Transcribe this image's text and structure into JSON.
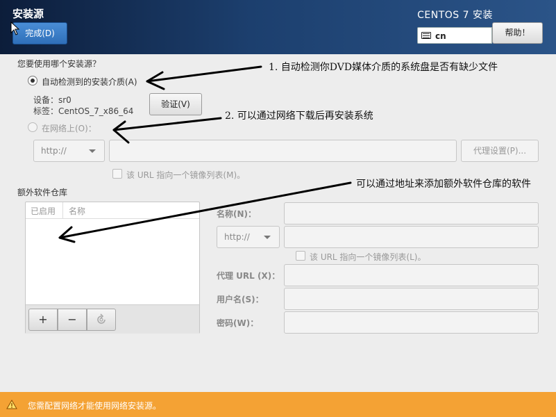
{
  "header": {
    "title": "安装源",
    "done_label": "完成(D)",
    "product": "CENTOS 7 安装",
    "keyboard_layout": "cn",
    "help_label": "帮助！"
  },
  "source": {
    "question": "您要使用哪个安装源？",
    "auto_label": "自动检测到的安装介质(A)",
    "auto_selected": true,
    "device_line": "设备：sr0",
    "label_line": "标签：CentOS_7_x86_64",
    "verify_label": "验证(V)",
    "network_label": "在网络上(O)：",
    "protocol_value": "http://",
    "url_value": "",
    "proxy_button": "代理设置(P)...",
    "mirror_checkbox_label": "该 URL 指向一个镜像列表(M)。"
  },
  "extra_repos": {
    "title": "额外软件仓库",
    "columns": [
      "已启用",
      "名称"
    ],
    "rows": [],
    "add_label": "+",
    "remove_label": "−",
    "refresh_label": "↻"
  },
  "repo_form": {
    "name_label": "名称(N)：",
    "protocol_value": "http://",
    "mirror_checkbox_label": "该 URL 指向一个镜像列表(L)。",
    "proxy_url_label": "代理 URL (X)：",
    "username_label": "用户名(S)：",
    "password_label": "密码(W)："
  },
  "warning": {
    "text": "您需配置网络才能使用网络安装源。",
    "color": "#f4a234"
  },
  "annotations": {
    "note1": "1. 自动检测你DVD媒体介质的系统盘是否有缺少文件",
    "note2": "2. 可以通过网络下载后再安装系统",
    "note3": "可以通过地址来添加额外软件仓库的软件"
  }
}
